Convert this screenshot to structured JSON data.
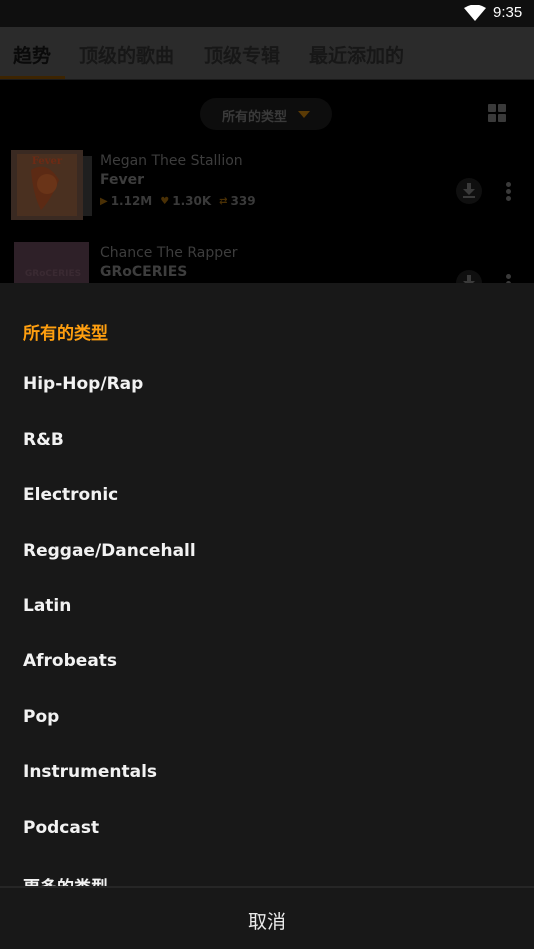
{
  "status_bar": {
    "time": "9:35",
    "wifi_icon": "wifi-icon"
  },
  "tabs": [
    {
      "label": "趋势",
      "active": true
    },
    {
      "label": "顶级的歌曲",
      "active": false
    },
    {
      "label": "顶级专辑",
      "active": false
    },
    {
      "label": "最近添加的",
      "active": false
    }
  ],
  "filter": {
    "genre_label": "所有的类型",
    "caret_icon": "caret-down-icon",
    "view_toggle_icon": "grid-view-icon"
  },
  "tracks": [
    {
      "artist": "Megan Thee Stallion",
      "title": "Fever",
      "plays": "1.12M",
      "favorites": "1.30K",
      "reposts": "339",
      "art_text": "Fever"
    },
    {
      "artist": "Chance The Rapper",
      "title": "GRoCERIES",
      "art_text": "GRoCERIES"
    }
  ],
  "genre_sheet": {
    "items": [
      {
        "label": "所有的类型",
        "selected": true
      },
      {
        "label": "Hip-Hop/Rap",
        "selected": false
      },
      {
        "label": "R&B",
        "selected": false
      },
      {
        "label": "Electronic",
        "selected": false
      },
      {
        "label": "Reggae/Dancehall",
        "selected": false
      },
      {
        "label": "Latin",
        "selected": false
      },
      {
        "label": "Afrobeats",
        "selected": false
      },
      {
        "label": "Pop",
        "selected": false
      },
      {
        "label": "Instrumentals",
        "selected": false
      },
      {
        "label": "Podcast",
        "selected": false
      },
      {
        "label": "更多的类型",
        "selected": false
      }
    ],
    "cancel_label": "取消"
  },
  "colors": {
    "accent": "#ff9f0f",
    "sheet_background": "#181818",
    "sheet_text": "#f2f2f2"
  }
}
